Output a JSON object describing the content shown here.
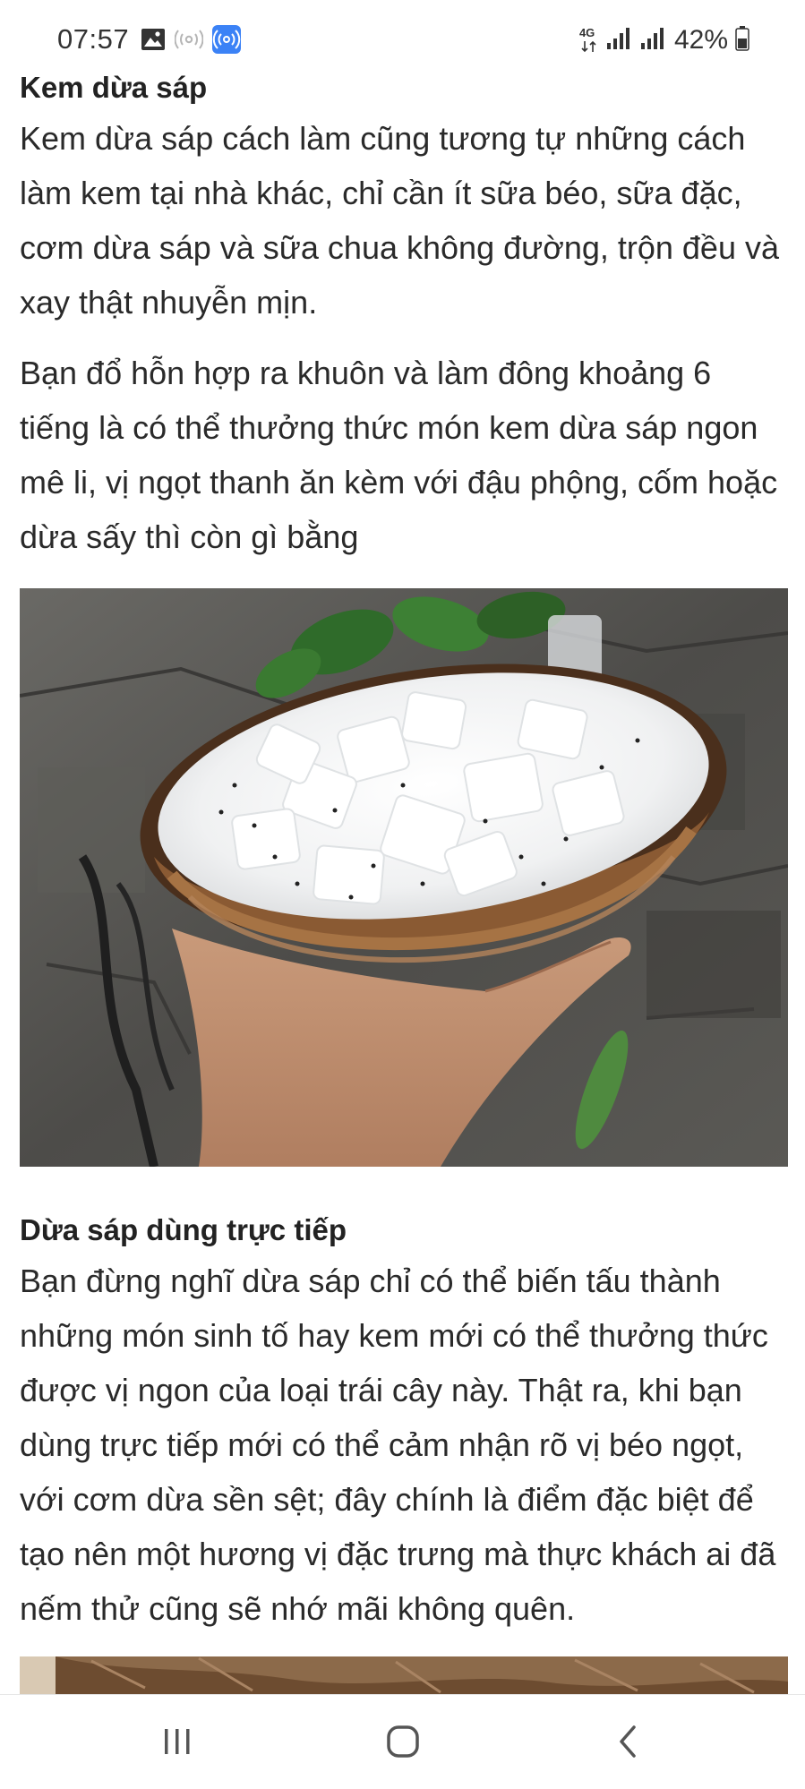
{
  "status_bar": {
    "time": "07:57",
    "left_icons": [
      "gallery-icon",
      "wifi-calling-icon",
      "hotspot-icon"
    ],
    "network_label": "4G",
    "battery_percent": "42%"
  },
  "article": {
    "section1": {
      "heading": "Kem dừa sáp",
      "paragraphs": [
        "Kem dừa sáp cách làm cũng tương tự những cách làm kem tại nhà khác, chỉ cần ít sữa béo, sữa đặc, cơm dừa sáp và sữa chua không đường, trộn đều và xay thật nhuyễn mịn.",
        "Bạn đổ hỗn hợp ra khuôn và làm đông khoảng 6 tiếng là có thể thưởng thức món kem dừa sáp ngon mê li, vị ngọt thanh ăn kèm với đậu phộng, cốm hoặc dừa sấy thì còn gì bằng"
      ]
    },
    "section2": {
      "heading": "Dừa sáp dùng trực tiếp",
      "paragraphs": [
        "Bạn đừng nghĩ dừa sáp chỉ có thể biến tấu thành những món sinh tố hay kem mới có thể thưởng thức được vị ngon của loại trái cây này. Thật ra, khi bạn dùng trực tiếp mới có thể cảm nhận rõ vị béo ngọt, với cơm dừa sền sệt; đây chính là điểm đặc biệt để tạo nên một hương vị đặc trưng mà thực khách ai đã nếm thử cũng sẽ nhớ mãi không quên."
      ]
    }
  },
  "nav_bar": {
    "buttons": [
      "recent-apps",
      "home",
      "back"
    ]
  },
  "colors": {
    "text": "#2a2a2a",
    "heading": "#222222",
    "status_text": "#333333",
    "hotspot_blue": "#3b82f6"
  }
}
